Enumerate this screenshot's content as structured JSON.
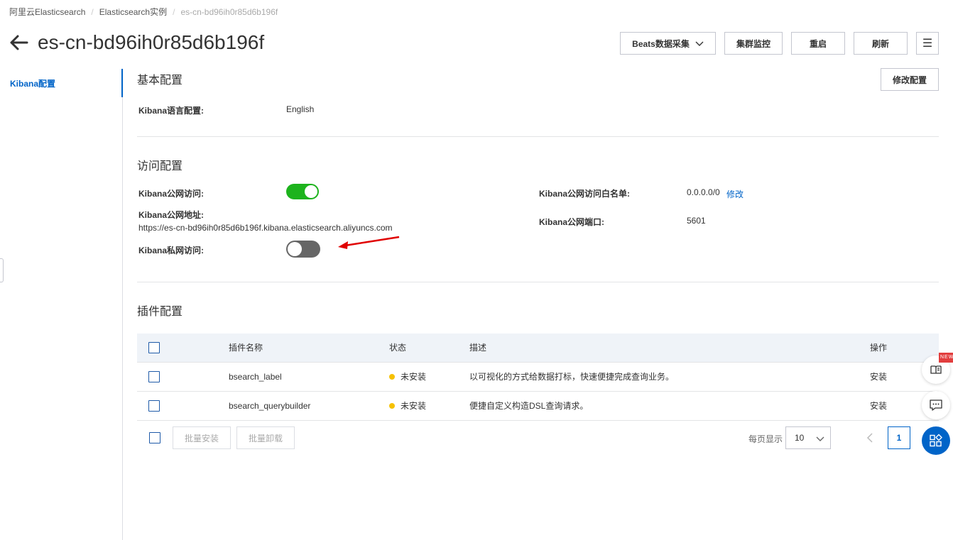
{
  "breadcrumb": {
    "items": [
      "阿里云Elasticsearch",
      "Elasticsearch实例",
      "es-cn-bd96ih0r85d6b196f"
    ],
    "separator": "/"
  },
  "header": {
    "title": "es-cn-bd96ih0r85d6b196f",
    "actions": {
      "beats": "Beats数据采集",
      "monitor": "集群监控",
      "restart": "重启",
      "refresh": "刷新",
      "menu": "☰"
    }
  },
  "sidebar": {
    "items": [
      {
        "label": "Kibana配置",
        "active": true
      }
    ]
  },
  "basic_config": {
    "title": "基本配置",
    "edit_button": "修改配置",
    "language_label": "Kibana语言配置:",
    "language_value": "English"
  },
  "access_config": {
    "title": "访问配置",
    "public_access_label": "Kibana公网访问:",
    "public_access_on": true,
    "public_address_label": "Kibana公网地址:",
    "public_address_value": "https://es-cn-bd96ih0r85d6b196f.kibana.elasticsearch.aliyuncs.com",
    "private_access_label": "Kibana私网访问:",
    "private_access_on": false,
    "whitelist_label": "Kibana公网访问白名单:",
    "whitelist_value": "0.0.0.0/0",
    "whitelist_edit": "修改",
    "port_label": "Kibana公网端口:",
    "port_value": "5601"
  },
  "plugin_config": {
    "title": "插件配置",
    "columns": [
      "插件名称",
      "状态",
      "描述",
      "操作"
    ],
    "rows": [
      {
        "name": "bsearch_label",
        "status": "未安装",
        "description": "以可视化的方式给数据打标，快速便捷完成查询业务。",
        "action": "安装"
      },
      {
        "name": "bsearch_querybuilder",
        "status": "未安装",
        "description": "便捷自定义构造DSL查询请求。",
        "action": "安装"
      }
    ],
    "batch_install": "批量安装",
    "batch_uninstall": "批量卸载",
    "page_size_label": "每页显示",
    "page_size_value": "10",
    "current_page": "1"
  },
  "floating": {
    "new_badge": "NEW"
  },
  "colors": {
    "primary": "#0064c8",
    "toggle_on": "#1db31d",
    "toggle_off": "#666666",
    "status_warning": "#f6c100",
    "annotation_arrow": "#e00000"
  }
}
